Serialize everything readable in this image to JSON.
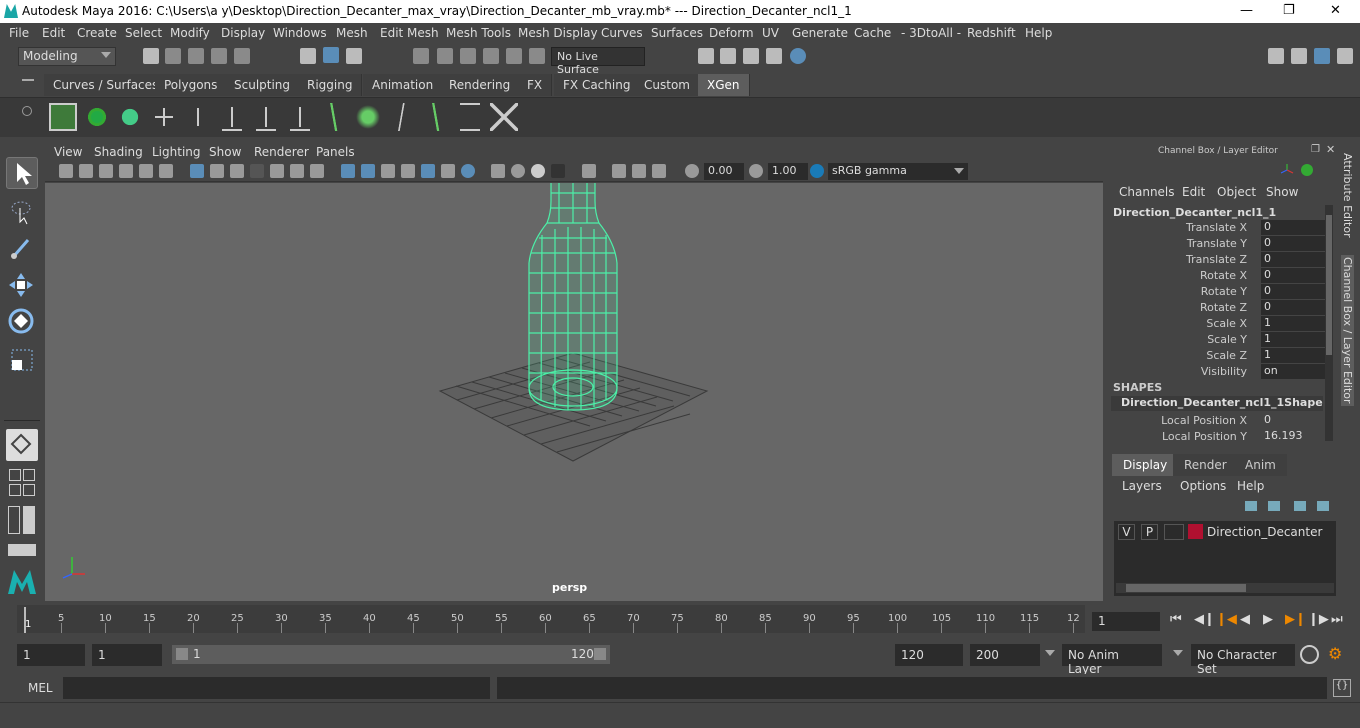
{
  "titlebar": {
    "title": "Autodesk Maya 2016: C:\\Users\\a y\\Desktop\\Direction_Decanter_max_vray\\Direction_Decanter_mb_vray.mb*   ---   Direction_Decanter_ncl1_1"
  },
  "menubar": [
    "File",
    "Edit",
    "Create",
    "Select",
    "Modify",
    "Display",
    "Windows",
    "Mesh",
    "Edit Mesh",
    "Mesh Tools",
    "Mesh Display",
    "Curves",
    "Surfaces",
    "Deform",
    "UV",
    "Generate",
    "Cache",
    "- 3DtoAll -",
    "Redshift",
    "Help"
  ],
  "status": {
    "mode": "Modeling",
    "live_surface": "No Live Surface"
  },
  "shelf_tabs": [
    "Curves / Surfaces",
    "Polygons",
    "Sculpting",
    "Rigging",
    "Animation",
    "Rendering",
    "FX",
    "FX Caching",
    "Custom",
    "XGen"
  ],
  "shelf_active": "XGen",
  "viewport": {
    "menu": [
      "View",
      "Shading",
      "Lighting",
      "Show",
      "Renderer",
      "Panels"
    ],
    "exposure": "0.00",
    "gamma": "1.00",
    "color_space": "sRGB gamma",
    "camera": "persp"
  },
  "channelbox": {
    "title": "Channel Box / Layer Editor",
    "menu": [
      "Channels",
      "Edit",
      "Object",
      "Show"
    ],
    "object": "Direction_Decanter_ncl1_1",
    "channels": [
      {
        "label": "Translate X",
        "value": "0"
      },
      {
        "label": "Translate Y",
        "value": "0"
      },
      {
        "label": "Translate Z",
        "value": "0"
      },
      {
        "label": "Rotate X",
        "value": "0"
      },
      {
        "label": "Rotate Y",
        "value": "0"
      },
      {
        "label": "Rotate Z",
        "value": "0"
      },
      {
        "label": "Scale X",
        "value": "1"
      },
      {
        "label": "Scale Y",
        "value": "1"
      },
      {
        "label": "Scale Z",
        "value": "1"
      },
      {
        "label": "Visibility",
        "value": "on"
      }
    ],
    "shapes_header": "SHAPES",
    "shape_name": "Direction_Decanter_ncl1_1Shape",
    "shape_channels": [
      {
        "label": "Local Position X",
        "value": "0"
      },
      {
        "label": "Local Position Y",
        "value": "16.193"
      }
    ]
  },
  "layers": {
    "tabs": [
      "Display",
      "Render",
      "Anim"
    ],
    "menu": [
      "Layers",
      "Options",
      "Help"
    ],
    "layer": {
      "v": "V",
      "p": "P",
      "name": "Direction_Decanter",
      "color": "#b01030"
    }
  },
  "side_tabs": [
    "Attribute Editor",
    "Channel Box / Layer Editor"
  ],
  "timeline": {
    "ticks": [
      "5",
      "10",
      "15",
      "20",
      "25",
      "30",
      "35",
      "40",
      "45",
      "50",
      "55",
      "60",
      "65",
      "70",
      "75",
      "80",
      "85",
      "90",
      "95",
      "100",
      "105",
      "110",
      "115",
      "12"
    ],
    "start_label": "1",
    "current_frame": "1"
  },
  "range": {
    "start": "1",
    "playback_start": "1",
    "slider_start": "1",
    "slider_end": "120",
    "playback_end": "120",
    "end": "200",
    "anim_layer": "No Anim Layer",
    "char_set": "No Character Set"
  },
  "mel": {
    "label": "MEL"
  },
  "colors": {
    "wire": "#4cf0a8",
    "accent": "#5d5d5d"
  }
}
